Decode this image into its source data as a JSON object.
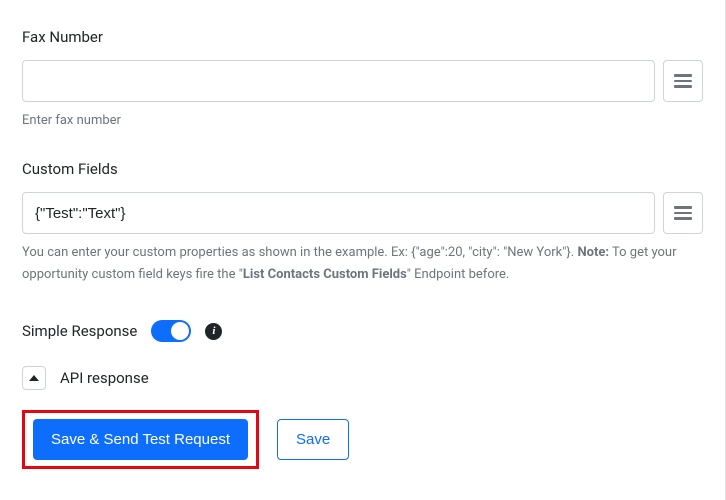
{
  "fax": {
    "label": "Fax Number",
    "value": "",
    "help": "Enter fax number"
  },
  "custom": {
    "label": "Custom Fields",
    "value": "{\"Test\":\"Text\"}",
    "help_pre": "You can enter your custom properties as shown in the example. Ex: {\"age\":20, \"city\": \"New York\"}. ",
    "help_note_label": "Note:",
    "help_mid": " To get your opportunity custom field keys fire the \"",
    "help_bold2": "List Contacts Custom Fields",
    "help_post": "\" Endpoint before."
  },
  "simple": {
    "label": "Simple Response",
    "on": true
  },
  "response_section": {
    "label": "API response"
  },
  "buttons": {
    "primary": "Save & Send Test Request",
    "secondary": "Save"
  }
}
